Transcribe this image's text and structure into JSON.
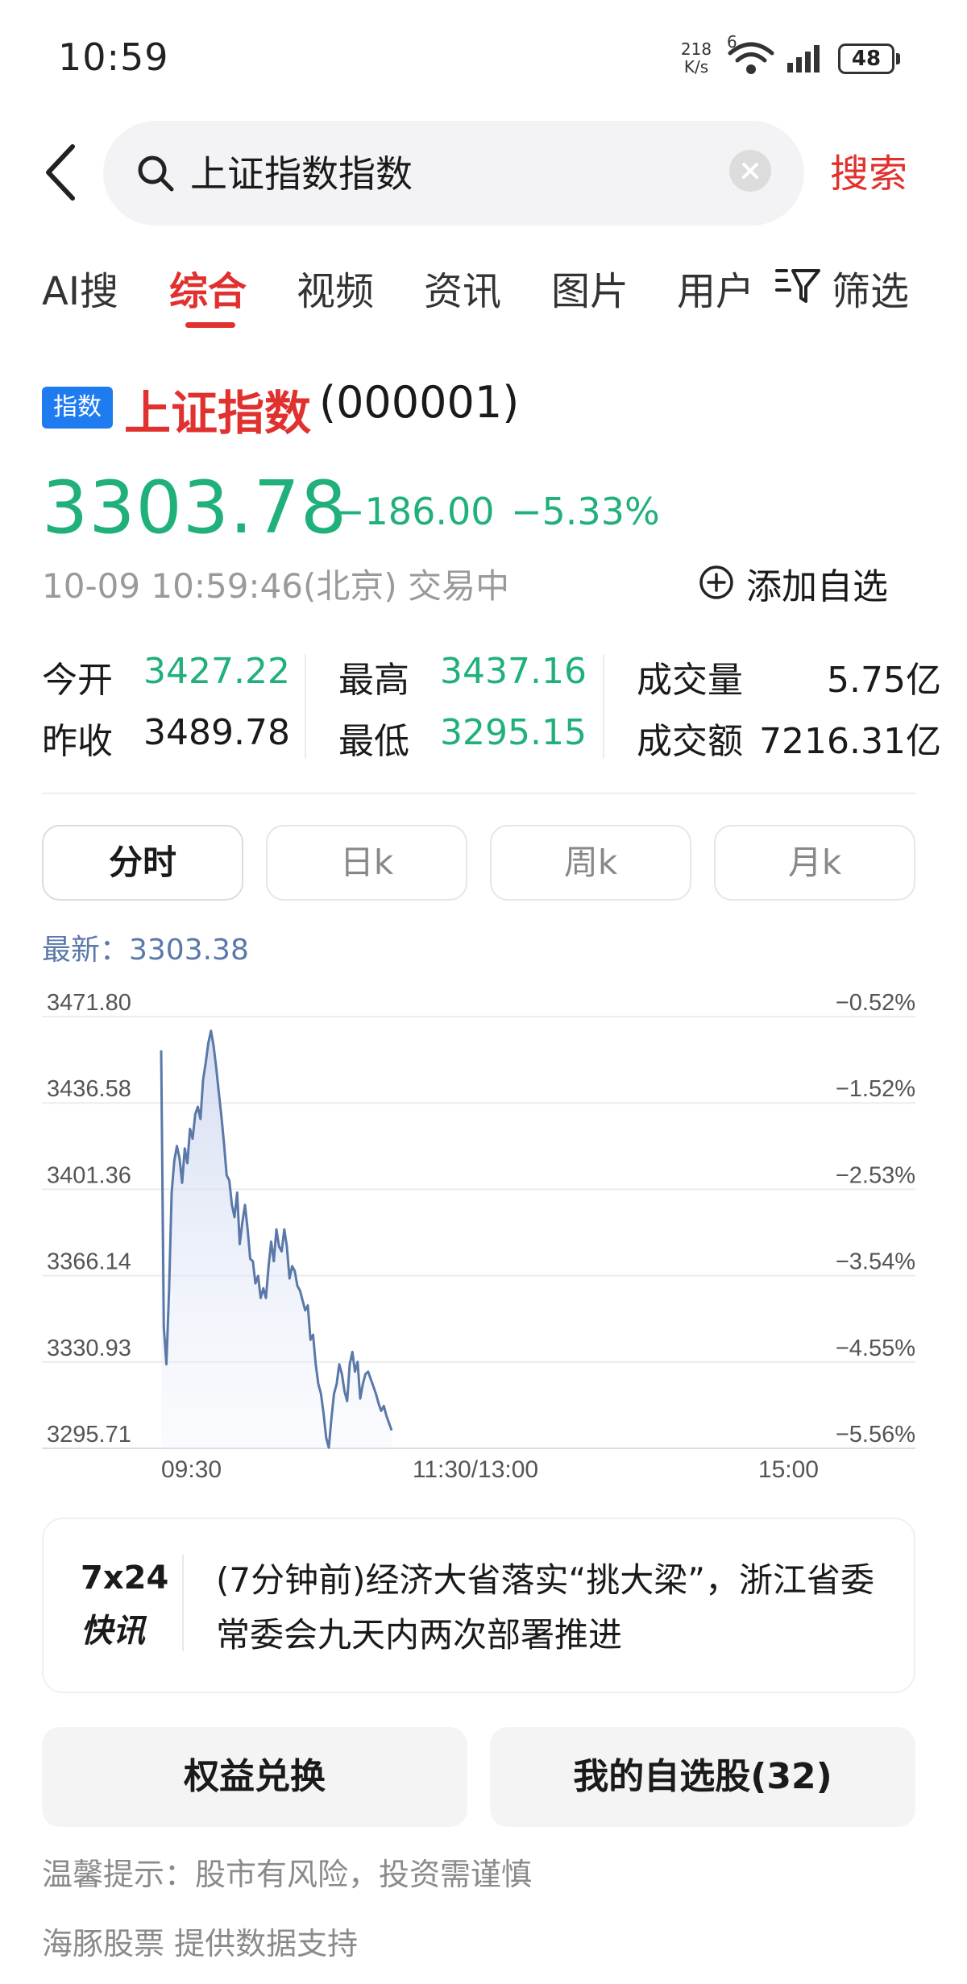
{
  "status_bar": {
    "time": "10:59",
    "net_speed_value": "218",
    "net_speed_unit": "K/s",
    "network": "6",
    "battery": "48"
  },
  "search": {
    "query": "上证指数指数",
    "button": "搜索"
  },
  "tabs": [
    "AI搜",
    "综合",
    "视频",
    "资讯",
    "图片",
    "用户"
  ],
  "filter_label": "筛选",
  "stock": {
    "tag": "指数",
    "name": "上证指数",
    "code": "(000001)",
    "price": "3303.78",
    "change": "−186.00",
    "change_pct": "−5.33%",
    "timestamp": "10-09 10:59:46(北京) 交易中",
    "add_watch": "添加自选",
    "color_down": "#20b07a"
  },
  "quotes": {
    "open_label": "今开",
    "open": "3427.22",
    "prev_close_label": "昨收",
    "prev_close": "3489.78",
    "high_label": "最高",
    "high": "3437.16",
    "low_label": "最低",
    "low": "3295.15",
    "volume_label": "成交量",
    "volume": "5.75亿",
    "amount_label": "成交额",
    "amount": "7216.31亿"
  },
  "period_tabs": [
    "分时",
    "日k",
    "周k",
    "月k"
  ],
  "latest": "最新：3303.38",
  "chart_data": {
    "type": "area",
    "title": "",
    "xlabel": "",
    "ylabel": "",
    "x_ticks": [
      "09:30",
      "11:30/13:00",
      "15:00"
    ],
    "y_ticks": [
      "3471.80",
      "3436.58",
      "3401.36",
      "3366.14",
      "3330.93",
      "3295.71"
    ],
    "y_pct_ticks": [
      "−0.52%",
      "−1.52%",
      "−2.53%",
      "−3.54%",
      "−4.55%",
      "−5.56%"
    ],
    "ylim": [
      3295.71,
      3471.8
    ],
    "x_minutes_total": 240,
    "x": [
      0,
      1,
      2,
      3,
      4,
      5,
      6,
      7,
      8,
      9,
      10,
      11,
      12,
      13,
      14,
      15,
      16,
      17,
      18,
      19,
      20,
      21,
      22,
      23,
      24,
      25,
      26,
      27,
      28,
      29,
      30,
      31,
      32,
      33,
      34,
      35,
      36,
      37,
      38,
      39,
      40,
      41,
      42,
      43,
      44,
      45,
      46,
      47,
      48,
      49,
      50,
      51,
      52,
      53,
      54,
      55,
      56,
      57,
      58,
      59,
      60,
      61,
      62,
      63,
      64,
      65,
      66,
      67,
      68,
      69,
      70,
      71,
      72,
      73,
      74,
      75,
      76,
      77,
      78,
      79,
      80,
      81,
      82,
      83,
      84,
      85,
      86,
      87,
      88
    ],
    "values": [
      3458,
      3345,
      3330,
      3360,
      3400,
      3413,
      3419,
      3414,
      3404,
      3418,
      3412,
      3426,
      3422,
      3432,
      3435,
      3430,
      3446,
      3453,
      3461,
      3466,
      3460,
      3451,
      3441,
      3431,
      3420,
      3407,
      3405,
      3395,
      3390,
      3400,
      3379,
      3388,
      3395,
      3385,
      3373,
      3372,
      3363,
      3366,
      3357,
      3361,
      3357,
      3370,
      3380,
      3372,
      3385,
      3378,
      3376,
      3385,
      3378,
      3365,
      3370,
      3368,
      3362,
      3360,
      3356,
      3352,
      3354,
      3340,
      3342,
      3330,
      3322,
      3318,
      3310,
      3300,
      3296,
      3308,
      3318,
      3322,
      3330,
      3326,
      3319,
      3315,
      3330,
      3335,
      3327,
      3331,
      3316,
      3322,
      3326,
      3327,
      3324,
      3321,
      3318,
      3314,
      3311,
      3313,
      3309,
      3306,
      3303
    ],
    "series": [
      {
        "name": "",
        "color": "#5a78a8"
      }
    ]
  },
  "news": {
    "logo_top": "7x24",
    "logo_bottom": "快讯",
    "text": "(7分钟前)经济大省落实“挑大梁”，浙江省委常委会九天内两次部署推进"
  },
  "buttons": {
    "rights": "权益兑换",
    "watchlist": "我的自选股(32)"
  },
  "tip": "温馨提示：股市有风险，投资需谨慎",
  "source": "海豚股票 提供数据支持"
}
